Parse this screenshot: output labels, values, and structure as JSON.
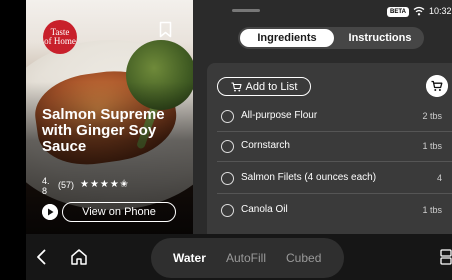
{
  "hero": {
    "brand_logo_lines": [
      "Taste",
      "of Home"
    ],
    "recipe_title": "Salmon Supreme with Ginger Soy Sauce",
    "rating_value": "4.\n8",
    "rating_count": "(57)",
    "stars_display": "★★★★✬",
    "view_on_phone_label": "View on Phone"
  },
  "status_bar": {
    "beta_label": "BETA",
    "time": "10:32"
  },
  "tabs": [
    {
      "label": "Ingredients",
      "active": true
    },
    {
      "label": "Instructions",
      "active": false
    }
  ],
  "list": {
    "add_to_list_label": "Add to List",
    "ingredients": [
      {
        "name": "All-purpose Flour",
        "amount": "2 tbs"
      },
      {
        "name": "Cornstarch",
        "amount": "1 tbs"
      },
      {
        "name": "Salmon Filets (4 ounces each)",
        "amount": "4"
      },
      {
        "name": "Canola Oil",
        "amount": "1 tbs"
      }
    ]
  },
  "bottom_bar": {
    "modes": [
      "Water",
      "AutoFill",
      "Cubed"
    ],
    "active_mode": "Water"
  },
  "colors": {
    "brand_red": "#c8202b",
    "panel_bg": "#2b2b2b",
    "list_bg": "#3a3a3a",
    "mode_inactive": "#9a9a9a"
  },
  "icons": {
    "bookmark": "bookmark-icon",
    "play": "play-icon",
    "wifi": "wifi-icon",
    "cart": "cart-icon",
    "back": "back-chevron-icon",
    "home": "home-icon",
    "grid": "grid-icon"
  }
}
